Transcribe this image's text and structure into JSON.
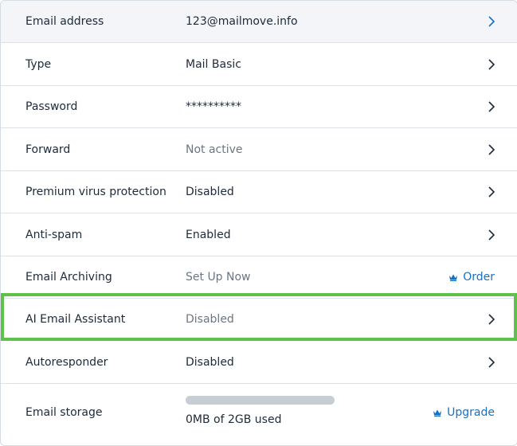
{
  "rows": [
    {
      "label": "Email address",
      "value": "123@mailmove.info",
      "action": "chevron-right-icon"
    },
    {
      "label": "Type",
      "value": "Mail Basic",
      "action": "chevron-right-icon"
    },
    {
      "label": "Password",
      "value": "**********",
      "action": "chevron-right-icon"
    },
    {
      "label": "Forward",
      "value": "Not active",
      "action": "chevron-right-icon"
    },
    {
      "label": "Premium virus protection",
      "value": "Disabled",
      "action": "chevron-right-icon"
    },
    {
      "label": "Anti-spam",
      "value": "Enabled",
      "action": "chevron-right-icon"
    },
    {
      "label": "Email Archiving",
      "value": "Set Up Now",
      "action_label": "Order",
      "action_icon": "crown-icon"
    },
    {
      "label": "AI Email Assistant",
      "value": "Disabled",
      "action": "chevron-right-icon",
      "highlighted": true
    },
    {
      "label": "Autoresponder",
      "value": "Disabled",
      "action": "chevron-right-icon"
    },
    {
      "label": "Email storage",
      "storage_text": "0MB of 2GB used",
      "storage_fraction": 0,
      "action_label": "Upgrade",
      "action_icon": "crown-icon"
    }
  ],
  "colors": {
    "accent": "#1670c4",
    "highlight": "#5ec24a",
    "text": "#1c2a3a",
    "muted": "#6b7683"
  }
}
